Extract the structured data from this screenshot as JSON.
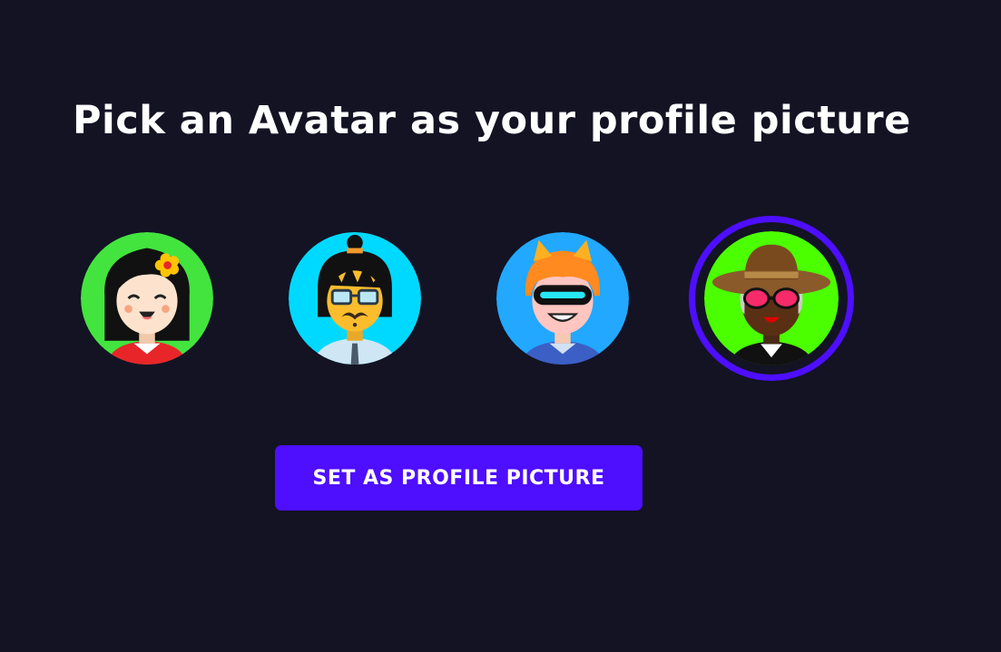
{
  "page": {
    "title": "Pick an Avatar as your profile picture",
    "background_color": "#131324"
  },
  "avatars": [
    {
      "name": "girl-with-flower",
      "background": "#43e43e",
      "selected": false
    },
    {
      "name": "boy-with-glasses",
      "background": "#00d9ff",
      "selected": false
    },
    {
      "name": "boy-with-visor",
      "background": "#22a8ff",
      "selected": false
    },
    {
      "name": "man-with-hat",
      "background": "#4bff00",
      "selected": true
    }
  ],
  "selection": {
    "accent_color": "#4e0eff"
  },
  "action_button": {
    "label": "SET AS PROFILE PICTURE",
    "color": "#4e0eff"
  }
}
